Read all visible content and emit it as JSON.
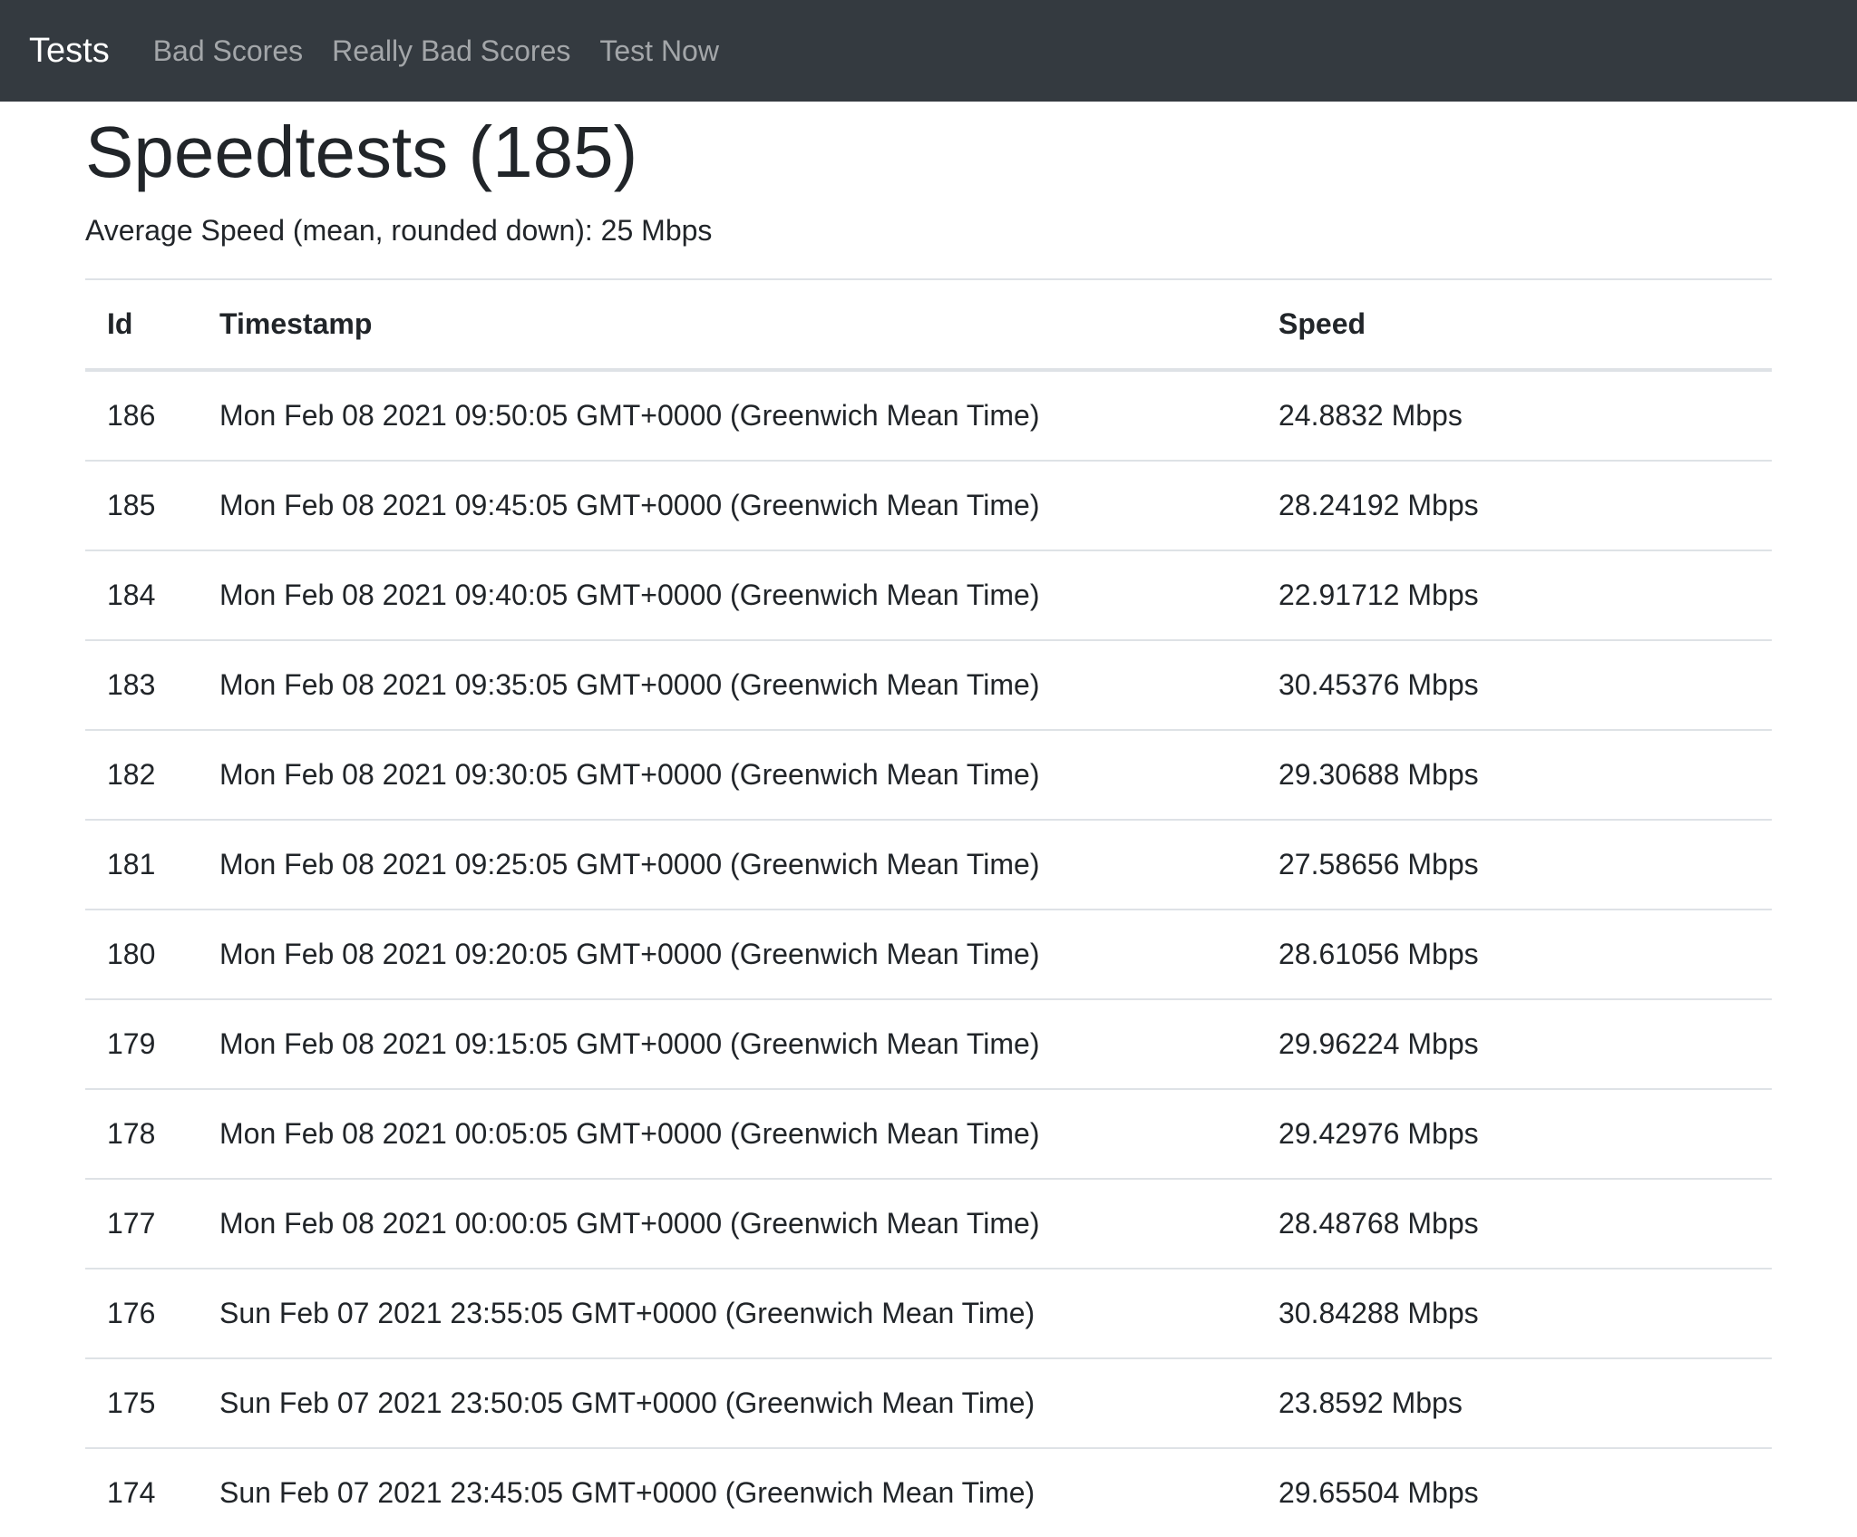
{
  "nav": {
    "brand": "Tests",
    "links": [
      "Bad Scores",
      "Really Bad Scores",
      "Test Now"
    ]
  },
  "page": {
    "title": "Speedtests (185)",
    "average": "Average Speed (mean, rounded down): 25 Mbps"
  },
  "table": {
    "headers": [
      "Id",
      "Timestamp",
      "Speed"
    ],
    "rows": [
      [
        "186",
        "Mon Feb 08 2021 09:50:05 GMT+0000 (Greenwich Mean Time)",
        "24.8832 Mbps"
      ],
      [
        "185",
        "Mon Feb 08 2021 09:45:05 GMT+0000 (Greenwich Mean Time)",
        "28.24192 Mbps"
      ],
      [
        "184",
        "Mon Feb 08 2021 09:40:05 GMT+0000 (Greenwich Mean Time)",
        "22.91712 Mbps"
      ],
      [
        "183",
        "Mon Feb 08 2021 09:35:05 GMT+0000 (Greenwich Mean Time)",
        "30.45376 Mbps"
      ],
      [
        "182",
        "Mon Feb 08 2021 09:30:05 GMT+0000 (Greenwich Mean Time)",
        "29.30688 Mbps"
      ],
      [
        "181",
        "Mon Feb 08 2021 09:25:05 GMT+0000 (Greenwich Mean Time)",
        "27.58656 Mbps"
      ],
      [
        "180",
        "Mon Feb 08 2021 09:20:05 GMT+0000 (Greenwich Mean Time)",
        "28.61056 Mbps"
      ],
      [
        "179",
        "Mon Feb 08 2021 09:15:05 GMT+0000 (Greenwich Mean Time)",
        "29.96224 Mbps"
      ],
      [
        "178",
        "Mon Feb 08 2021 00:05:05 GMT+0000 (Greenwich Mean Time)",
        "29.42976 Mbps"
      ],
      [
        "177",
        "Mon Feb 08 2021 00:00:05 GMT+0000 (Greenwich Mean Time)",
        "28.48768 Mbps"
      ],
      [
        "176",
        "Sun Feb 07 2021 23:55:05 GMT+0000 (Greenwich Mean Time)",
        "30.84288 Mbps"
      ],
      [
        "175",
        "Sun Feb 07 2021 23:50:05 GMT+0000 (Greenwich Mean Time)",
        "23.8592 Mbps"
      ],
      [
        "174",
        "Sun Feb 07 2021 23:45:05 GMT+0000 (Greenwich Mean Time)",
        "29.65504 Mbps"
      ]
    ]
  }
}
